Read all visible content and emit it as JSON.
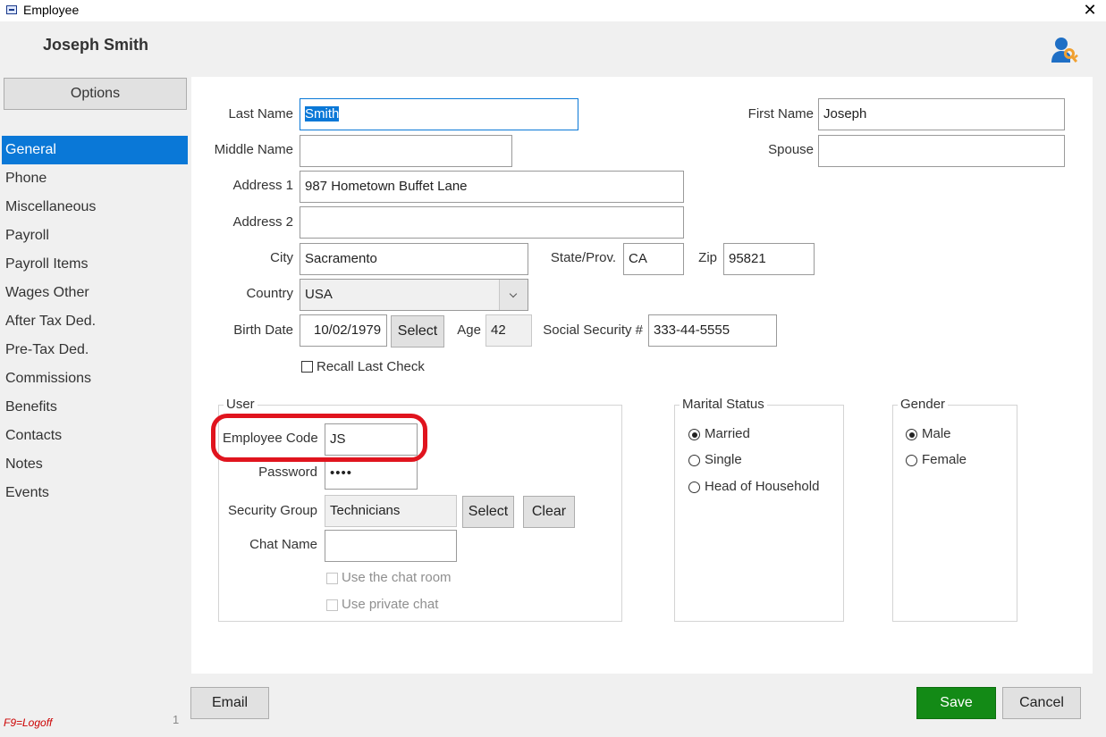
{
  "window": {
    "title": "Employee"
  },
  "header": {
    "name": "Joseph Smith"
  },
  "sidebar": {
    "options_label": "Options",
    "items": [
      {
        "label": "General",
        "active": true
      },
      {
        "label": "Phone"
      },
      {
        "label": "Miscellaneous"
      },
      {
        "label": "Payroll"
      },
      {
        "label": "Payroll Items"
      },
      {
        "label": "Wages Other"
      },
      {
        "label": "After Tax Ded."
      },
      {
        "label": "Pre-Tax Ded."
      },
      {
        "label": "Commissions"
      },
      {
        "label": "Benefits"
      },
      {
        "label": "Contacts"
      },
      {
        "label": "Notes"
      },
      {
        "label": "Events"
      }
    ],
    "logoff_hint": "F9=Logoff",
    "page_number": "1"
  },
  "form": {
    "last_name": {
      "label": "Last Name",
      "value": "Smith"
    },
    "first_name": {
      "label": "First Name",
      "value": "Joseph"
    },
    "middle_name": {
      "label": "Middle Name",
      "value": ""
    },
    "spouse": {
      "label": "Spouse",
      "value": ""
    },
    "address1": {
      "label": "Address 1",
      "value": "987 Hometown Buffet Lane"
    },
    "address2": {
      "label": "Address 2",
      "value": ""
    },
    "city": {
      "label": "City",
      "value": "Sacramento"
    },
    "state": {
      "label": "State/Prov.",
      "value": "CA"
    },
    "zip": {
      "label": "Zip",
      "value": "95821"
    },
    "country": {
      "label": "Country",
      "value": "USA"
    },
    "birth_date": {
      "label": "Birth Date",
      "value": "10/02/1979",
      "select_label": "Select"
    },
    "age": {
      "label": "Age",
      "value": "42"
    },
    "ssn": {
      "label": "Social Security #",
      "value": "333-44-5555"
    },
    "recall_last_check": {
      "label": "Recall Last Check",
      "checked": false
    }
  },
  "user_group": {
    "title": "User",
    "employee_code": {
      "label": "Employee Code",
      "value": "JS"
    },
    "password": {
      "label": "Password",
      "value": "••••"
    },
    "security_group": {
      "label": "Security Group",
      "value": "Technicians",
      "select_label": "Select",
      "clear_label": "Clear"
    },
    "chat_name": {
      "label": "Chat Name",
      "value": ""
    },
    "use_chat_room": {
      "label": "Use the chat room",
      "checked": false
    },
    "use_private_chat": {
      "label": "Use private chat",
      "checked": false
    }
  },
  "marital_status": {
    "title": "Marital Status",
    "options": [
      "Married",
      "Single",
      "Head of Household"
    ],
    "selected": "Married"
  },
  "gender": {
    "title": "Gender",
    "options": [
      "Male",
      "Female"
    ],
    "selected": "Male"
  },
  "footer": {
    "email_label": "Email",
    "save_label": "Save",
    "cancel_label": "Cancel"
  },
  "colors": {
    "accent": "#0a78d7",
    "save": "#138a16",
    "highlight": "#e0141e"
  },
  "icons": [
    "window-icon",
    "close-icon",
    "user-key-icon",
    "chevron-down-icon"
  ]
}
